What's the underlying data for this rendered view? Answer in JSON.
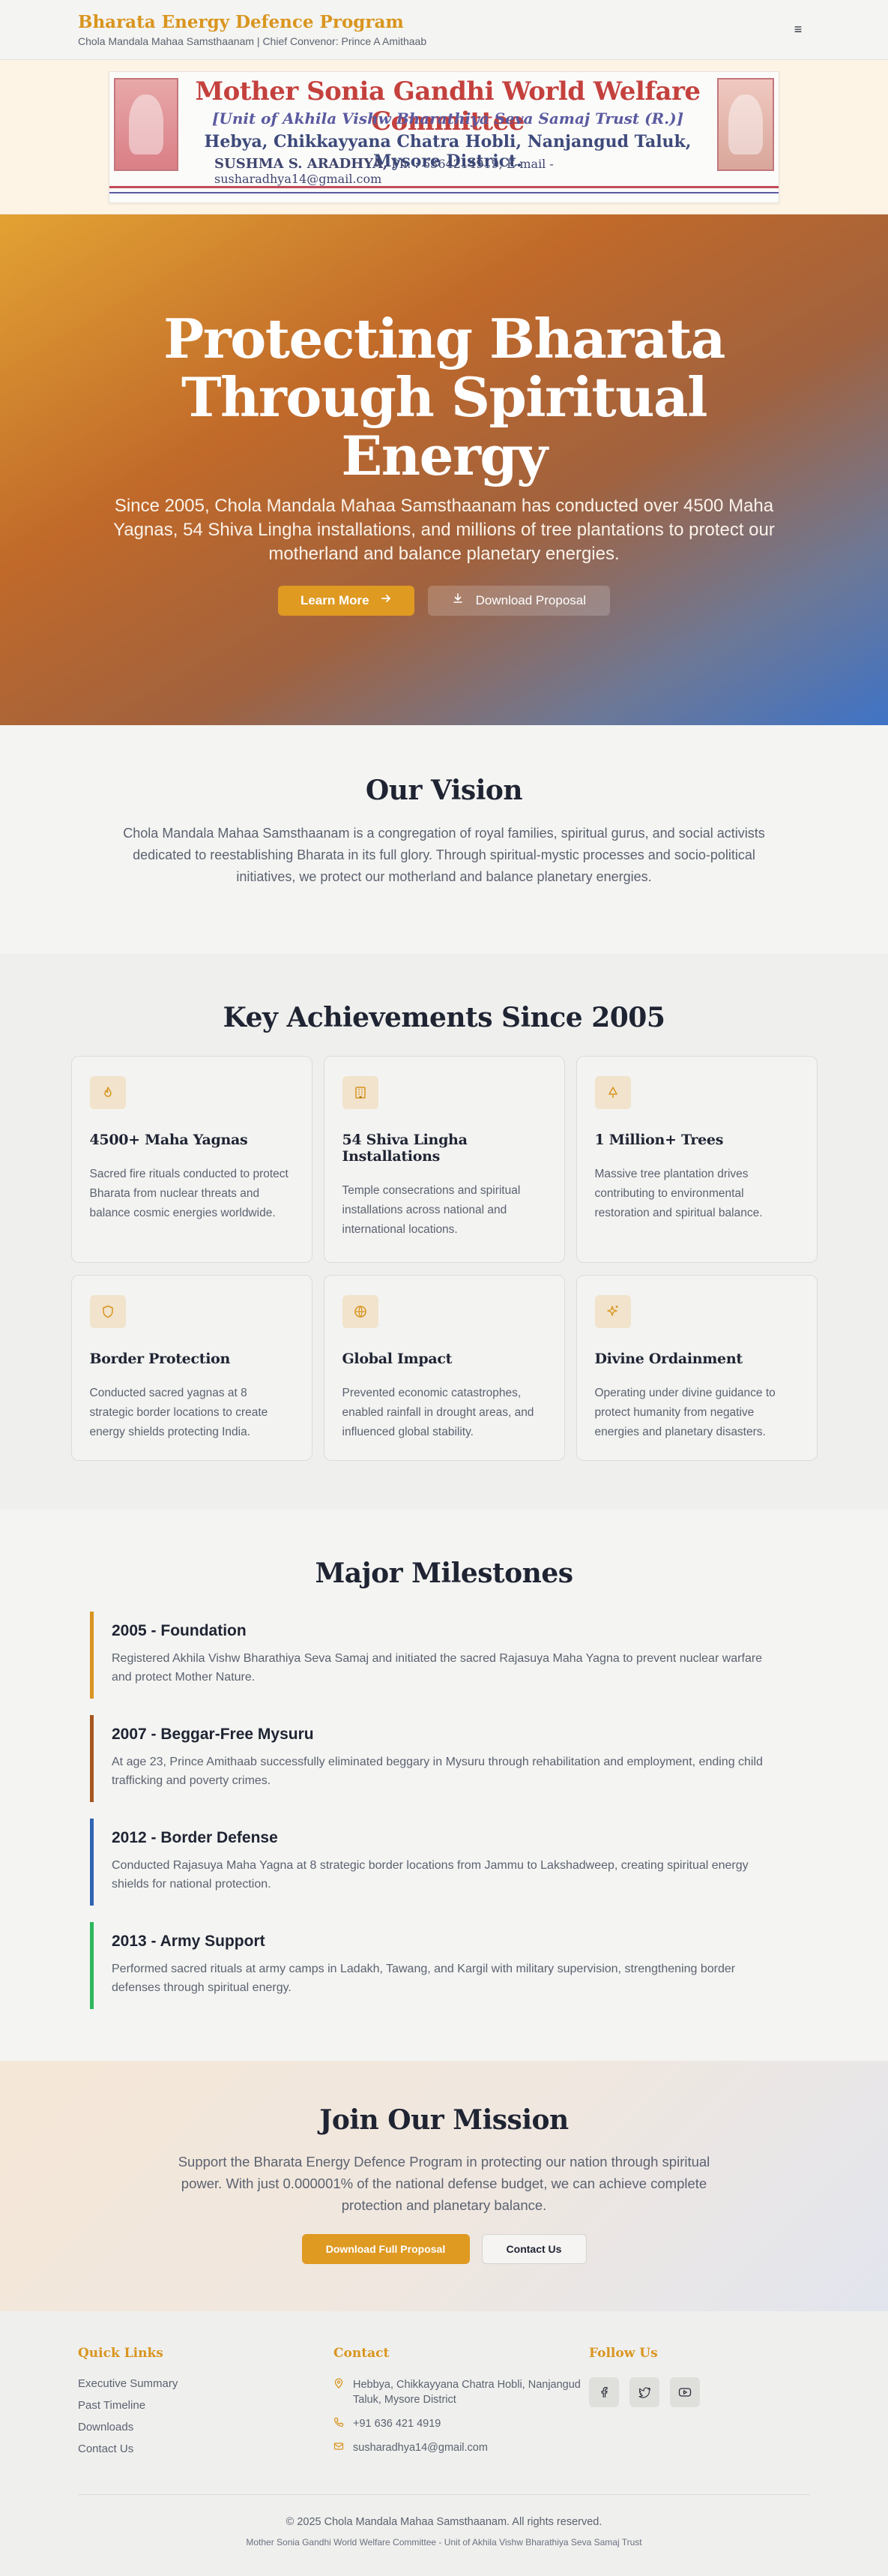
{
  "header": {
    "title": "Bharata Energy Defence Program",
    "subtitle": "Chola Mandala Mahaa Samsthaanam | Chief Convenor: Prince A Amithaab",
    "menu_icon": "≡"
  },
  "banner": {
    "title": "Mother Sonia Gandhi World Welfare Committee",
    "line2": "[Unit of Akhila Vishw Bharathiya Seva Samaj Trust (R.)]",
    "line3": "Hebya, Chikkayyana Chatra Hobli, Nanjangud Taluk, Mysore District.",
    "name": "SUSHMA S. ARADHYA,",
    "contact": "Ph. : 6364214919, E-mail - susharadhya14@gmail.com"
  },
  "hero": {
    "title": "Protecting Bharata Through Spiritual Energy",
    "description": "Since 2005, Chola Mandala Mahaa Samsthaanam has conducted over 4500 Maha Yagnas, 54 Shiva Lingha installations, and millions of tree plantations to protect our motherland and balance planetary energies.",
    "learn_more": "Learn More",
    "download": "Download Proposal"
  },
  "vision": {
    "title": "Our Vision",
    "text": "Chola Mandala Mahaa Samsthaanam is a congregation of royal families, spiritual gurus, and social activists dedicated to reestablishing Bharata in its full glory. Through spiritual-mystic processes and socio-political initiatives, we protect our motherland and balance planetary energies."
  },
  "achievements": {
    "title": "Key Achievements Since 2005",
    "cards": [
      {
        "icon": "flame-icon",
        "title": "4500+ Maha Yagnas",
        "text": "Sacred fire rituals conducted to protect Bharata from nuclear threats and balance cosmic energies worldwide."
      },
      {
        "icon": "building-icon",
        "title": "54 Shiva Lingha Installations",
        "text": "Temple consecrations and spiritual installations across national and international locations."
      },
      {
        "icon": "tree-icon",
        "title": "1 Million+ Trees",
        "text": "Massive tree plantation drives contributing to environmental restoration and spiritual balance."
      },
      {
        "icon": "shield-icon",
        "title": "Border Protection",
        "text": "Conducted sacred yagnas at 8 strategic border locations to create energy shields protecting India."
      },
      {
        "icon": "globe-icon",
        "title": "Global Impact",
        "text": "Prevented economic catastrophes, enabled rainfall in drought areas, and influenced global stability."
      },
      {
        "icon": "sparkles-icon",
        "title": "Divine Ordainment",
        "text": "Operating under divine guidance to protect humanity from negative energies and planetary disasters."
      }
    ]
  },
  "milestones": {
    "title": "Major Milestones",
    "items": [
      {
        "title": "2005 - Foundation",
        "text": "Registered Akhila Vishw Bharathiya Seva Samaj and initiated the sacred Rajasuya Maha Yagna to prevent nuclear warfare and protect Mother Nature."
      },
      {
        "title": "2007 - Beggar-Free Mysuru",
        "text": "At age 23, Prince Amithaab successfully eliminated beggary in Mysuru through rehabilitation and employment, ending child trafficking and poverty crimes."
      },
      {
        "title": "2012 - Border Defense",
        "text": "Conducted Rajasuya Maha Yagna at 8 strategic border locations from Jammu to Lakshadweep, creating spiritual energy shields for national protection."
      },
      {
        "title": "2013 - Army Support",
        "text": "Performed sacred rituals at army camps in Ladakh, Tawang, and Kargil with military supervision, strengthening border defenses through spiritual energy."
      }
    ]
  },
  "join": {
    "title": "Join Our Mission",
    "text": "Support the Bharata Energy Defence Program in protecting our nation through spiritual power. With just 0.000001% of the national defense budget, we can achieve complete protection and planetary balance.",
    "download": "Download Full Proposal",
    "contact": "Contact Us"
  },
  "footer": {
    "quick_links_title": "Quick Links",
    "quick_links": [
      "Executive Summary",
      "Past Timeline",
      "Downloads",
      "Contact Us"
    ],
    "contact_title": "Contact",
    "address": "Hebbya, Chikkayyana Chatra Hobli, Nanjangud Taluk, Mysore District",
    "phone": "+91 636 421 4919",
    "email": "susharadhya14@gmail.com",
    "follow_title": "Follow Us",
    "copyright": "© 2025 Chola Mandala Mahaa Samsthaanam. All rights reserved.",
    "sub": "Mother Sonia Gandhi World Welfare Committee - Unit of Akhila Vishw Bharathiya Seva Samaj Trust"
  },
  "colors": {
    "accent": "#df9a22",
    "text": "#1f2433",
    "muted": "#5b6270",
    "hero_start": "#e3a233",
    "hero_end": "#3f73c6"
  }
}
